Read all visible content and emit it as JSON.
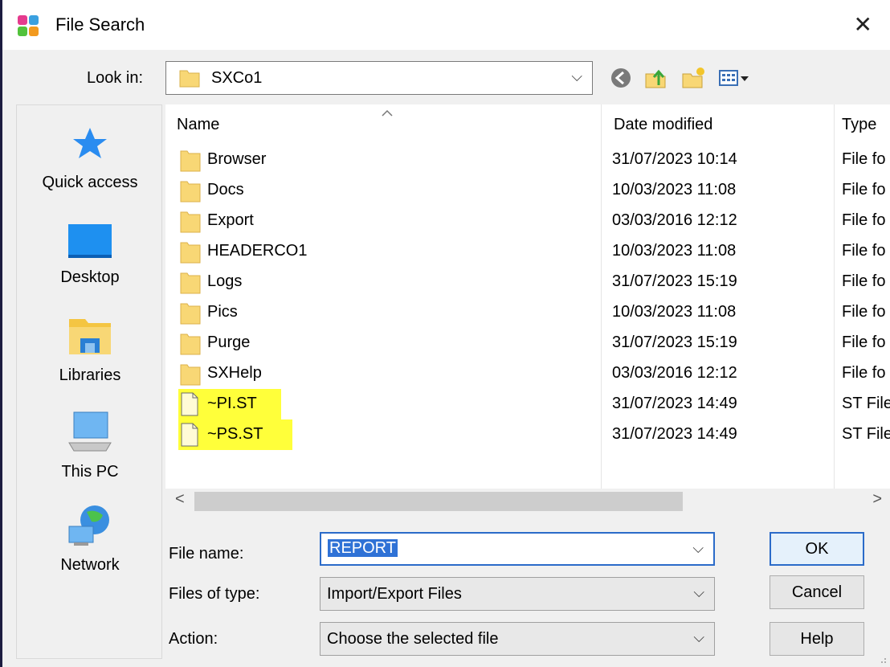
{
  "window": {
    "title": "File Search",
    "close_glyph": "✕"
  },
  "lookin": {
    "label": "Look in:",
    "value": "SXCo1",
    "dropdown_glyph": "⌵"
  },
  "toolbar": {
    "back_icon": "back-icon",
    "up_icon": "up-folder-icon",
    "new_icon": "new-folder-icon",
    "view_icon": "view-menu-icon"
  },
  "places": [
    {
      "label": "Quick access",
      "icon": "star-icon"
    },
    {
      "label": "Desktop",
      "icon": "desktop-icon"
    },
    {
      "label": "Libraries",
      "icon": "libraries-icon"
    },
    {
      "label": "This PC",
      "icon": "computer-icon"
    },
    {
      "label": "Network",
      "icon": "network-icon"
    }
  ],
  "columns": {
    "name": "Name",
    "date": "Date modified",
    "type": "Type"
  },
  "files": [
    {
      "name": "Browser",
      "date": "31/07/2023 10:14",
      "type": "File fo",
      "kind": "folder"
    },
    {
      "name": "Docs",
      "date": "10/03/2023 11:08",
      "type": "File fo",
      "kind": "folder"
    },
    {
      "name": "Export",
      "date": "03/03/2016 12:12",
      "type": "File fo",
      "kind": "folder"
    },
    {
      "name": "HEADERCO1",
      "date": "10/03/2023 11:08",
      "type": "File fo",
      "kind": "folder"
    },
    {
      "name": "Logs",
      "date": "31/07/2023 15:19",
      "type": "File fo",
      "kind": "folder"
    },
    {
      "name": "Pics",
      "date": "10/03/2023 11:08",
      "type": "File fo",
      "kind": "folder"
    },
    {
      "name": "Purge",
      "date": "31/07/2023 15:19",
      "type": "File fo",
      "kind": "folder"
    },
    {
      "name": "SXHelp",
      "date": "03/03/2016 12:12",
      "type": "File fo",
      "kind": "folder"
    },
    {
      "name": "~PI.ST",
      "date": "31/07/2023 14:49",
      "type": "ST File",
      "kind": "file",
      "highlight": "#ffff3a"
    },
    {
      "name": "~PS.ST",
      "date": "31/07/2023 14:49",
      "type": "ST File",
      "kind": "file",
      "highlight": "#ffff3a"
    }
  ],
  "scroll": {
    "left_glyph": "<",
    "right_glyph": ">"
  },
  "form": {
    "filename_label": "File name:",
    "filename_value": "REPORT",
    "filetype_label": "Files of type:",
    "filetype_value": "Import/Export Files",
    "action_label": "Action:",
    "action_value": "Choose the selected file",
    "dropdown_glyph": "⌵"
  },
  "buttons": {
    "ok": "OK",
    "cancel": "Cancel",
    "help": "Help"
  },
  "colors": {
    "accent": "#2b6bc9",
    "folder": "#f8d775",
    "highlight": "#ffff3a"
  }
}
